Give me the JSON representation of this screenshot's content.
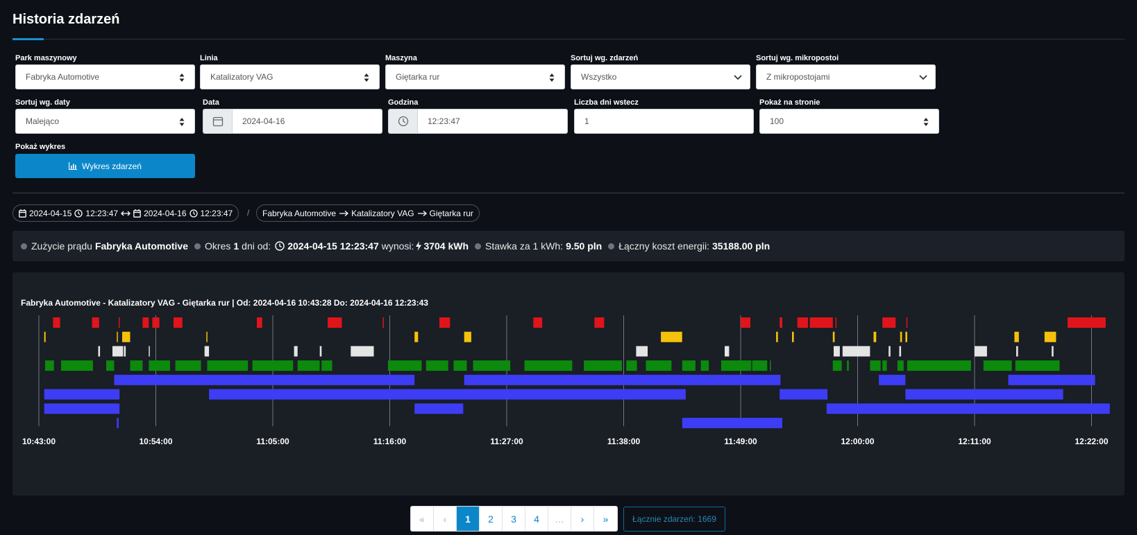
{
  "page": {
    "title": "Historia zdarzeń"
  },
  "filters": {
    "park": {
      "label": "Park maszynowy",
      "value": "Fabryka Automotive"
    },
    "line": {
      "label": "Linia",
      "value": "Katalizatory VAG"
    },
    "machine": {
      "label": "Maszyna",
      "value": "Giętarka rur"
    },
    "sort_events": {
      "label": "Sortuj wg. zdarzeń",
      "value": "Wszystko"
    },
    "sort_micro": {
      "label": "Sortuj wg. mikropostoi",
      "value": "Z mikropostojami"
    },
    "sort_date": {
      "label": "Sortuj wg. daty",
      "value": "Malejąco"
    },
    "date": {
      "label": "Data",
      "value": "2024-04-16"
    },
    "time": {
      "label": "Godzina",
      "value": "12:23:47"
    },
    "days_back": {
      "label": "Liczba dni wstecz",
      "value": "1"
    },
    "per_page": {
      "label": "Pokaż na stronie",
      "value": "100"
    },
    "show_chart": {
      "label": "Pokaż wykres",
      "button": "Wykres zdarzeń"
    }
  },
  "range_pill": {
    "from_date": "2024-04-15",
    "from_time": "12:23:47",
    "to_date": "2024-04-16",
    "to_time": "12:23:47"
  },
  "breadcrumb_sep": "/",
  "path_pill": {
    "park": "Fabryka Automotive",
    "line": "Katalizatory VAG",
    "machine": "Giętarka rur"
  },
  "energy": {
    "usage_label": "Zużycie prądu",
    "usage_park": "Fabryka Automotive",
    "period_prefix": "Okres",
    "period_days": "1",
    "period_suffix": "dni od:",
    "period_start": "2024-04-15 12:23:47",
    "amount_label": "wynosi:",
    "amount": "3704 kWh",
    "rate_label": "Stawka za 1 kWh:",
    "rate": "9.50 pln",
    "cost_label": "Łączny koszt energii:",
    "cost": "35188.00 pln"
  },
  "colors": {
    "red": "#e0141b",
    "yellow": "#f5c20b",
    "white": "#e4e4e4",
    "green": "#0b8a0b",
    "blue": "#3d3df5",
    "accent": "#0b87c9"
  },
  "chart_data": {
    "type": "timeline",
    "title": "Fabryka Automotive - Katalizatory VAG - Giętarka rur | Od: 2024-04-16 10:43:28 Do: 2024-04-16 12:23:43",
    "x_ticks": [
      "10:43:00",
      "10:54:00",
      "11:05:00",
      "11:16:00",
      "11:27:00",
      "11:38:00",
      "11:49:00",
      "12:00:00",
      "12:11:00",
      "12:22:00"
    ],
    "x_range": [
      "10:43:00",
      "12:23:43"
    ],
    "grid": true,
    "tracks": [
      {
        "color": "red",
        "segments": [
          [
            "10:44:20",
            "10:45:00"
          ],
          [
            "10:48:00",
            "10:48:40"
          ],
          [
            "10:50:30",
            "10:50:35"
          ],
          [
            "10:52:45",
            "10:53:20"
          ],
          [
            "10:53:40",
            "10:54:20"
          ],
          [
            "10:55:40",
            "10:56:30"
          ],
          [
            "11:03:30",
            "11:04:00"
          ],
          [
            "11:10:10",
            "11:11:30"
          ],
          [
            "11:15:20",
            "11:15:25"
          ],
          [
            "11:20:40",
            "11:21:40"
          ],
          [
            "11:29:30",
            "11:30:20"
          ],
          [
            "11:35:15",
            "11:36:10"
          ],
          [
            "11:49:00",
            "11:49:55"
          ],
          [
            "11:52:40",
            "11:52:55"
          ],
          [
            "11:54:20",
            "11:55:20"
          ],
          [
            "11:55:30",
            "11:57:40"
          ],
          [
            "11:57:55",
            "11:58:00"
          ],
          [
            "12:02:20",
            "12:03:35"
          ],
          [
            "12:04:35",
            "12:04:40"
          ],
          [
            "12:19:45",
            "12:23:20"
          ]
        ]
      },
      {
        "color": "yellow",
        "segments": [
          [
            "10:43:30",
            "10:43:38"
          ],
          [
            "10:50:20",
            "10:50:25"
          ],
          [
            "10:50:50",
            "10:51:35"
          ],
          [
            "10:58:45",
            "10:58:50"
          ],
          [
            "11:18:20",
            "11:18:40"
          ],
          [
            "11:23:00",
            "11:23:40"
          ],
          [
            "11:41:30",
            "11:43:30"
          ],
          [
            "11:52:20",
            "11:52:30"
          ],
          [
            "11:53:50",
            "11:54:00"
          ],
          [
            "11:57:40",
            "11:57:50"
          ],
          [
            "12:01:30",
            "12:01:45"
          ],
          [
            "12:04:00",
            "12:04:10"
          ],
          [
            "12:04:30",
            "12:04:40"
          ],
          [
            "12:14:45",
            "12:15:10"
          ],
          [
            "12:17:35",
            "12:18:40"
          ]
        ]
      },
      {
        "color": "white",
        "segments": [
          [
            "10:48:35",
            "10:48:45"
          ],
          [
            "10:49:55",
            "10:50:55"
          ],
          [
            "10:51:00",
            "10:51:10"
          ],
          [
            "10:53:20",
            "10:53:25"
          ],
          [
            "10:58:35",
            "10:59:00"
          ],
          [
            "11:07:00",
            "11:07:20"
          ],
          [
            "11:09:25",
            "11:09:35"
          ],
          [
            "11:12:20",
            "11:14:30"
          ],
          [
            "11:39:10",
            "11:40:15"
          ],
          [
            "11:47:30",
            "11:47:55"
          ],
          [
            "11:57:45",
            "11:58:20"
          ],
          [
            "11:58:35",
            "12:01:10"
          ],
          [
            "12:02:55",
            "12:03:05"
          ],
          [
            "12:03:55",
            "12:04:05"
          ],
          [
            "12:11:00",
            "12:12:10"
          ],
          [
            "12:14:55",
            "12:15:05"
          ],
          [
            "12:18:15",
            "12:18:25"
          ]
        ]
      },
      {
        "color": "green",
        "segments": [
          [
            "10:43:35",
            "10:44:25"
          ],
          [
            "10:45:05",
            "10:48:05"
          ],
          [
            "10:49:20",
            "10:50:05"
          ],
          [
            "10:51:35",
            "10:52:45"
          ],
          [
            "10:53:20",
            "10:55:20"
          ],
          [
            "10:55:50",
            "10:58:15"
          ],
          [
            "10:58:50",
            "11:02:40"
          ],
          [
            "11:03:05",
            "11:06:55"
          ],
          [
            "11:07:20",
            "11:09:25"
          ],
          [
            "11:09:35",
            "11:10:35"
          ],
          [
            "11:15:50",
            "11:19:00"
          ],
          [
            "11:19:25",
            "11:21:30"
          ],
          [
            "11:22:00",
            "11:23:15"
          ],
          [
            "11:23:50",
            "11:27:20"
          ],
          [
            "11:28:40",
            "11:33:10"
          ],
          [
            "11:34:15",
            "11:37:50"
          ],
          [
            "11:38:15",
            "11:39:15"
          ],
          [
            "11:40:05",
            "11:42:30"
          ],
          [
            "11:43:30",
            "11:44:45"
          ],
          [
            "11:45:15",
            "11:46:00"
          ],
          [
            "11:47:10",
            "11:50:00"
          ],
          [
            "11:50:05",
            "11:51:30"
          ],
          [
            "11:51:45",
            "11:51:50"
          ],
          [
            "11:57:40",
            "11:58:30"
          ],
          [
            "11:59:00",
            "11:59:10"
          ],
          [
            "12:01:10",
            "12:02:10"
          ],
          [
            "12:02:20",
            "12:02:45"
          ],
          [
            "12:03:45",
            "12:04:20"
          ],
          [
            "12:04:40",
            "12:10:40"
          ],
          [
            "12:11:50",
            "12:14:30"
          ],
          [
            "12:14:50",
            "12:19:00"
          ]
        ]
      },
      {
        "color": "blue",
        "segments": [
          [
            "10:50:05",
            "11:18:20"
          ],
          [
            "11:23:00",
            "11:52:45"
          ],
          [
            "12:02:00",
            "12:04:30"
          ],
          [
            "12:14:10",
            "12:22:20"
          ]
        ]
      },
      {
        "color": "blue",
        "segments": [
          [
            "10:43:30",
            "10:50:35"
          ],
          [
            "10:59:00",
            "11:43:50"
          ],
          [
            "11:52:40",
            "11:57:10"
          ],
          [
            "12:04:30",
            "12:19:20"
          ]
        ]
      },
      {
        "color": "blue",
        "segments": [
          [
            "10:43:30",
            "10:50:35"
          ],
          [
            "11:18:20",
            "11:22:55"
          ],
          [
            "11:57:05",
            "12:23:43"
          ]
        ]
      },
      {
        "color": "blue",
        "segments": [
          [
            "10:50:20",
            "10:50:30"
          ],
          [
            "11:43:30",
            "11:52:55"
          ]
        ]
      }
    ]
  },
  "pagination": {
    "first": "«",
    "prev": "‹",
    "pages": [
      "1",
      "2",
      "3",
      "4"
    ],
    "ellipsis": "…",
    "next": "›",
    "last": "»",
    "current": "1"
  },
  "total_label": "Łącznie zdarzeń: 1669"
}
